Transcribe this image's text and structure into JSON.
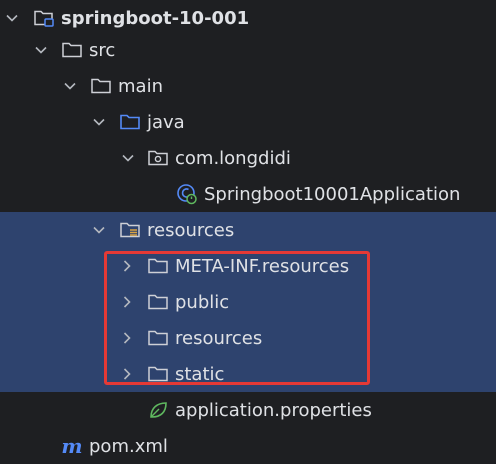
{
  "tree": {
    "project": {
      "label": "springboot-10-001"
    },
    "src": {
      "label": "src"
    },
    "main": {
      "label": "main"
    },
    "java": {
      "label": "java"
    },
    "package": {
      "label": "com.longdidi"
    },
    "app_class": {
      "label": "Springboot10001Application"
    },
    "resources": {
      "label": "resources"
    },
    "meta_inf": {
      "label": "META-INF.resources"
    },
    "public": {
      "label": "public"
    },
    "resources_sub": {
      "label": "resources"
    },
    "static": {
      "label": "static"
    },
    "properties": {
      "label": "application.properties"
    },
    "pom": {
      "label": "pom.xml"
    }
  },
  "colors": {
    "background": "#1e1f22",
    "selection": "#2e436e",
    "highlight_border": "#e53935",
    "text": "#dfe1e5",
    "folder_stroke": "#ced0d6",
    "source_folder": "#548af7",
    "spring_green": "#5fb85f"
  },
  "icons": {
    "project": "module-folder-icon",
    "folder": "folder-icon",
    "source_root": "source-root-folder-icon",
    "package": "package-icon",
    "app_class": "spring-boot-class-icon",
    "resources_root": "resources-root-folder-icon",
    "properties": "spring-properties-icon",
    "pom": "maven-icon"
  }
}
